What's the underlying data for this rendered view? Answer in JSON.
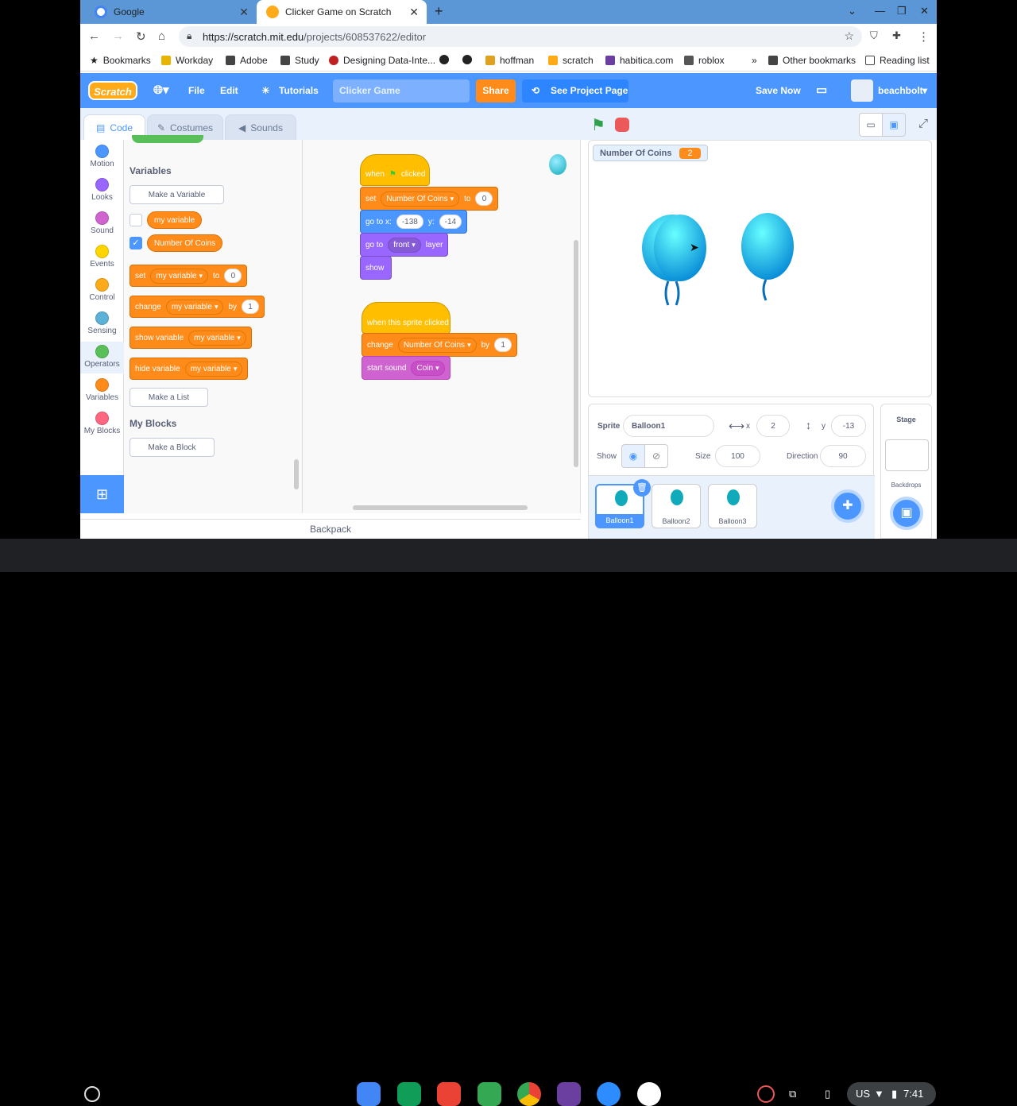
{
  "browser": {
    "tabs": [
      {
        "title": "Google"
      },
      {
        "title": "Clicker Game on Scratch"
      }
    ],
    "url_host": "https://scratch.mit.edu",
    "url_path": "/projects/608537622/editor",
    "bookmarks": [
      "Bookmarks",
      "Workday",
      "Adobe",
      "Study",
      "Designing Data-Inte...",
      "hoffman",
      "scratch",
      "habitica.com",
      "roblox",
      "Other bookmarks",
      "Reading list"
    ]
  },
  "menu": {
    "logo": "Scratch",
    "file": "File",
    "edit": "Edit",
    "tutorials": "Tutorials",
    "project_title": "Clicker Game",
    "share": "Share",
    "see_project": "See Project Page",
    "save_now": "Save Now",
    "username": "beachbolt"
  },
  "editor_tabs": {
    "code": "Code",
    "costumes": "Costumes",
    "sounds": "Sounds"
  },
  "categories": [
    {
      "label": "Motion",
      "color": "#4c97ff"
    },
    {
      "label": "Looks",
      "color": "#9966ff"
    },
    {
      "label": "Sound",
      "color": "#cf63cf"
    },
    {
      "label": "Events",
      "color": "#ffd500"
    },
    {
      "label": "Control",
      "color": "#ffab19"
    },
    {
      "label": "Sensing",
      "color": "#5cb1d6"
    },
    {
      "label": "Operators",
      "color": "#59c059"
    },
    {
      "label": "Variables",
      "color": "#ff8c1a"
    },
    {
      "label": "My Blocks",
      "color": "#ff6680"
    }
  ],
  "palette": {
    "variables_heading": "Variables",
    "make_variable": "Make a Variable",
    "var1": "my variable",
    "var2": "Number Of Coins",
    "set": "set",
    "change": "change",
    "show_variable": "show variable",
    "hide_variable": "hide variable",
    "to": "to",
    "by": "by",
    "set_value": "0",
    "change_value": "1",
    "dropdown_var": "my variable",
    "make_list": "Make a List",
    "myblocks_heading": "My Blocks",
    "make_block": "Make a Block"
  },
  "script1": {
    "when": "when",
    "clicked": "clicked",
    "set": "set",
    "set_var": "Number Of Coins",
    "to": "to",
    "set_val": "0",
    "goto": "go to x:",
    "x": "-138",
    "y_label": "y:",
    "y": "-14",
    "goto_layer": "go to",
    "layer_opt": "front",
    "layer": "layer",
    "show": "show"
  },
  "script2": {
    "hat": "when this sprite clicked",
    "change": "change",
    "var": "Number Of Coins",
    "by": "by",
    "val": "1",
    "start_sound": "start sound",
    "sound": "Coin"
  },
  "zoom": {
    "in": "+",
    "out": "−",
    "reset": "="
  },
  "backpack": "Backpack",
  "stage": {
    "monitor_label": "Number Of Coins",
    "monitor_value": "2"
  },
  "sprite_info": {
    "sprite_label": "Sprite",
    "sprite_name": "Balloon1",
    "x_label": "x",
    "x": "2",
    "y_label": "y",
    "y": "-13",
    "show_label": "Show",
    "size_label": "Size",
    "size": "100",
    "direction_label": "Direction",
    "direction": "90"
  },
  "sprites": [
    "Balloon1",
    "Balloon2",
    "Balloon3"
  ],
  "stage_pane": {
    "title": "Stage",
    "backdrops": "Backdrops"
  },
  "tray": {
    "lang": "US",
    "time": "7:41"
  }
}
